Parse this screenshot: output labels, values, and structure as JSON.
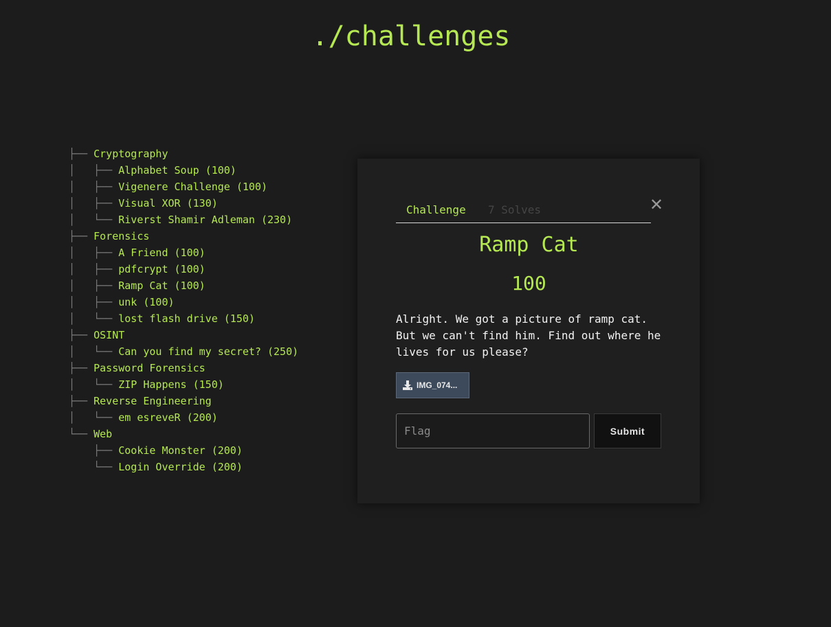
{
  "page": {
    "title": "./challenges"
  },
  "tree": [
    {
      "branch": "├── ",
      "label": "Cryptography",
      "kind": "category"
    },
    {
      "branch": "│   ├── ",
      "label": "Alphabet Soup (100)",
      "kind": "challenge"
    },
    {
      "branch": "│   ├── ",
      "label": "Vigenere Challenge (100)",
      "kind": "challenge"
    },
    {
      "branch": "│   ├── ",
      "label": "Visual XOR (130)",
      "kind": "challenge"
    },
    {
      "branch": "│   └── ",
      "label": "Riverst Shamir Adleman (230)",
      "kind": "challenge"
    },
    {
      "branch": "├── ",
      "label": "Forensics",
      "kind": "category"
    },
    {
      "branch": "│   ├── ",
      "label": "A Friend (100)",
      "kind": "challenge"
    },
    {
      "branch": "│   ├── ",
      "label": "pdfcrypt (100)",
      "kind": "challenge"
    },
    {
      "branch": "│   ├── ",
      "label": "Ramp Cat (100)",
      "kind": "challenge"
    },
    {
      "branch": "│   ├── ",
      "label": "unk (100)",
      "kind": "challenge"
    },
    {
      "branch": "│   └── ",
      "label": "lost flash drive (150)",
      "kind": "challenge"
    },
    {
      "branch": "├── ",
      "label": "OSINT",
      "kind": "category"
    },
    {
      "branch": "│   └── ",
      "label": "Can you find my secret? (250)",
      "kind": "challenge"
    },
    {
      "branch": "├── ",
      "label": "Password Forensics",
      "kind": "category"
    },
    {
      "branch": "│   └── ",
      "label": "ZIP Happens (150)",
      "kind": "challenge"
    },
    {
      "branch": "├── ",
      "label": "Reverse Engineering",
      "kind": "category"
    },
    {
      "branch": "│   └── ",
      "label": "em esreveR (200)",
      "kind": "challenge"
    },
    {
      "branch": "└── ",
      "label": "Web",
      "kind": "category"
    },
    {
      "branch": "    ├── ",
      "label": "Cookie Monster (200)",
      "kind": "challenge"
    },
    {
      "branch": "    └── ",
      "label": "Login Override (200)",
      "kind": "challenge"
    }
  ],
  "modal": {
    "tab_challenge": "Challenge",
    "tab_solves": "7 Solves",
    "close_symbol": "✕",
    "name": "Ramp Cat",
    "value": "100",
    "description": "Alright. We got a picture of ramp cat. But we can't find him. Find out where he lives for us please?",
    "file_label": "IMG_074...",
    "flag_placeholder": "Flag",
    "flag_value": "",
    "submit_label": "Submit"
  },
  "colors": {
    "accent": "#b5e853",
    "background": "#1c1c1c",
    "modal_bg": "#1f1f1f",
    "file_button": "#3d4a5c"
  },
  "icons": {
    "file_button": "download-icon",
    "close": "close-icon"
  }
}
